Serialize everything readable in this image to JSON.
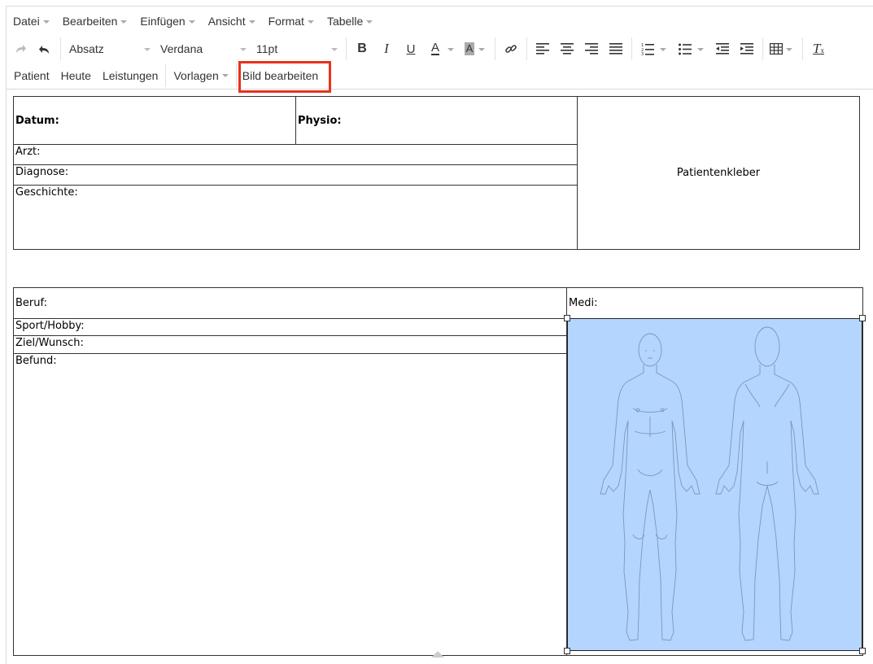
{
  "menubar": {
    "items": [
      "Datei",
      "Bearbeiten",
      "Einfügen",
      "Ansicht",
      "Format",
      "Tabelle"
    ]
  },
  "toolbar": {
    "block_format": "Absatz",
    "font_family": "Verdana",
    "font_size": "11pt",
    "icons": [
      "redo-icon",
      "undo-icon",
      "bold-icon",
      "italic-icon",
      "underline-icon",
      "text-color-icon",
      "background-color-icon",
      "link-icon",
      "align-left-icon",
      "align-center-icon",
      "align-right-icon",
      "align-justify-icon",
      "numbered-list-icon",
      "bullet-list-icon",
      "outdent-icon",
      "indent-icon",
      "table-icon",
      "clear-formatting-icon"
    ]
  },
  "custombar": {
    "patient": "Patient",
    "heute": "Heute",
    "leistungen": "Leistungen",
    "vorlagen": "Vorlagen",
    "bild_bearbeiten": "Bild bearbeiten"
  },
  "doc": {
    "datum": "Datum:",
    "physio": "Physio:",
    "arzt": "Arzt:",
    "diagnose": "Diagnose:",
    "geschichte": "Geschichte:",
    "patientenkleber": "Patientenkleber",
    "beruf": "Beruf:",
    "medi": "Medi:",
    "sport": "Sport/Hobby:",
    "ziel": "Ziel/Wunsch:",
    "befund": "Befund:"
  },
  "colors": {
    "selection": "#b4d5fe",
    "highlight": "#e8321c"
  }
}
